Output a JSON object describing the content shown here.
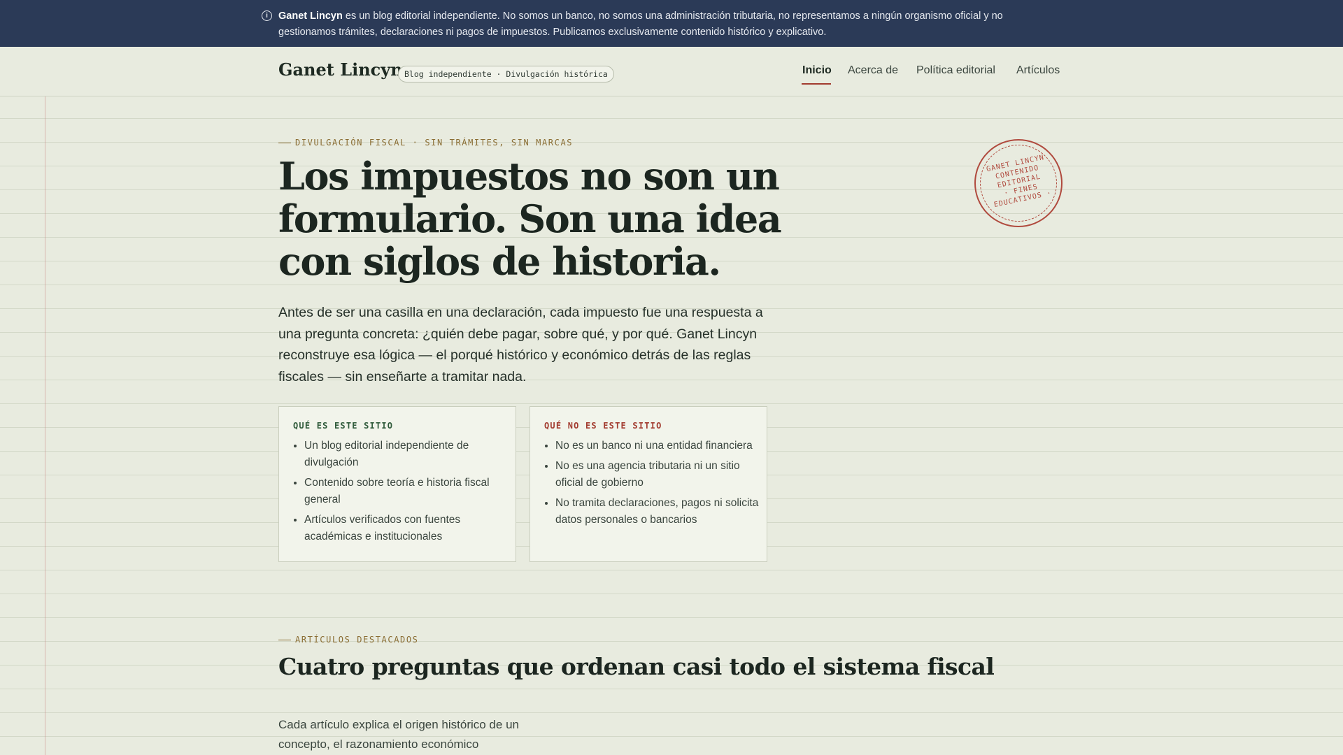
{
  "notice": {
    "brand": "Ganet Lincyn",
    "text": " es un blog editorial independiente. No somos un banco, no somos una administración tributaria, no representamos a ningún organismo oficial y no gestionamos trámites, declaraciones ni pagos de impuestos. Publicamos exclusivamente contenido histórico y explicativo.",
    "icon": "info-icon"
  },
  "header": {
    "brand": "Ganet Lincyn",
    "tag": "Blog independiente · Divulgación histórica",
    "nav": [
      {
        "label": "Inicio",
        "active": true
      },
      {
        "label": "Acerca de"
      },
      {
        "label": "Política editorial"
      },
      {
        "label": "Artículos"
      }
    ]
  },
  "hero": {
    "eyebrow": "DIVULGACIÓN FISCAL · SIN TRÁMITES, SIN MARCAS",
    "title": "Los impuestos no son un formulario. Son una idea con siglos de historia.",
    "text": "Antes de ser una casilla en una declaración, cada impuesto fue una respuesta a una pregunta concreta: ¿quién debe pagar, sobre qué, y por qué. Ganet Lincyn reconstruye esa lógica — el porqué histórico y económico detrás de las reglas fiscales — sin enseñarte a tramitar nada."
  },
  "cards": {
    "is": {
      "title": "QUÉ ES ESTE SITIO",
      "items": [
        "Un blog editorial independiente de divulgación",
        "Contenido sobre teoría e historia fiscal general",
        "Artículos verificados con fuentes académicas e institucionales"
      ]
    },
    "is_not": {
      "title": "QUÉ NO ES ESTE SITIO",
      "items": [
        "No es un banco ni una entidad financiera",
        "No es una agencia tributaria ni un sitio oficial de gobierno",
        "No tramita declaraciones, pagos ni solicita datos personales o bancarios"
      ]
    }
  },
  "stamp": {
    "line1": "GANET LINCYN",
    "line2": "CONTENIDO",
    "line3": "EDITORIAL",
    "line4": "· FINES",
    "line5": "EDUCATIVOS ·"
  },
  "featured": {
    "eyebrow": "ARTÍCULOS DESTACADOS",
    "title": "Cuatro preguntas que ordenan casi todo el sistema fiscal",
    "text": "Cada artículo explica el origen histórico de un concepto, el razonamiento económico"
  },
  "colors": {
    "notice_bg": "#2b3a57",
    "page_bg": "#e8ebdf",
    "accent_red": "#a23b2f",
    "accent_gold": "#8a6d33",
    "is_title": "#2f5a3a",
    "is_not_title": "#a23b2f"
  }
}
